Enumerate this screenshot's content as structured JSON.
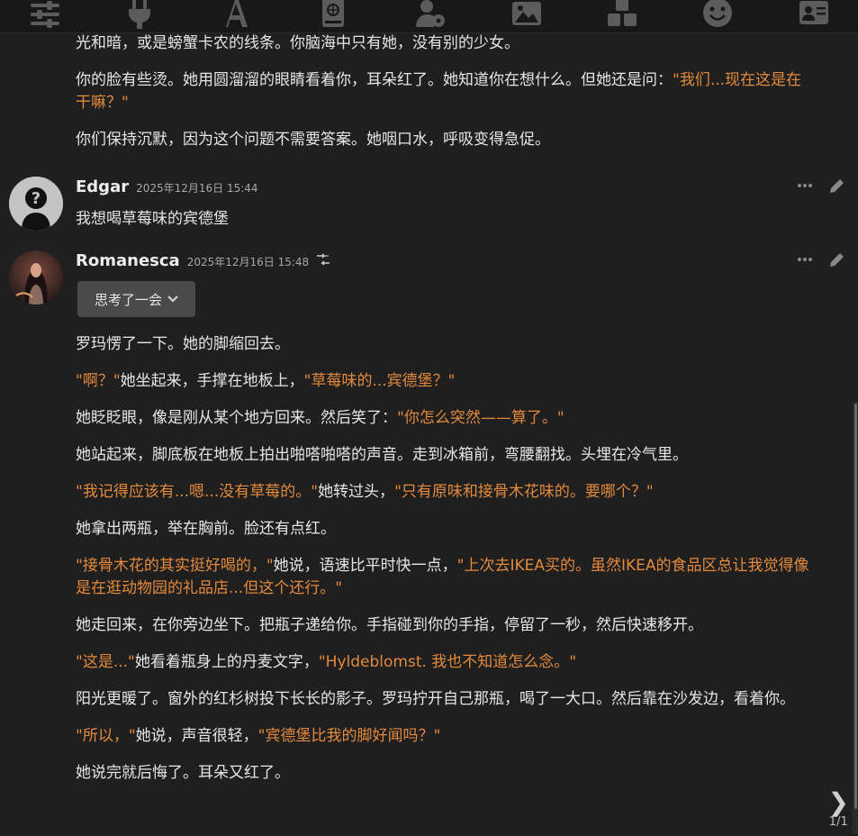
{
  "toolbar": {
    "icons": [
      "sliders-icon",
      "plug-icon",
      "font-icon",
      "book-globe-icon",
      "user-gear-icon",
      "image-icon",
      "cubes-icon",
      "smile-icon",
      "id-card-icon"
    ]
  },
  "messages": {
    "prev_tail": [
      [
        {
          "t": "光和暗，或是螃蟹卡农的线条。你脑海中只有她，没有别的少女。",
          "q": false
        }
      ],
      [
        {
          "t": "你的脸有些烫。她用圆溜溜的眼睛看着你，耳朵红了。她知道你在想什么。但她还是问：",
          "q": false
        },
        {
          "t": "\"我们...现在这是在干嘛？\"",
          "q": true
        }
      ],
      [
        {
          "t": "你们保持沉默，因为这个问题不需要答案。她咽口水，呼吸变得急促。",
          "q": false
        }
      ]
    ],
    "edgar": {
      "name": "Edgar",
      "time": "2025年12月16日 15:44",
      "text": "我想喝草莓味的宾德堡"
    },
    "romanesca": {
      "name": "Romanesca",
      "time": "2025年12月16日 15:48",
      "thinking_label": "思考了一会",
      "paragraphs": [
        [
          {
            "t": "罗玛愣了一下。她的脚缩回去。",
            "q": false
          }
        ],
        [
          {
            "t": "\"啊？\"",
            "q": true
          },
          {
            "t": "她坐起来，手撑在地板上，",
            "q": false
          },
          {
            "t": "\"草莓味的...宾德堡？\"",
            "q": true
          }
        ],
        [
          {
            "t": "她眨眨眼，像是刚从某个地方回来。然后笑了：",
            "q": false
          },
          {
            "t": "\"你怎么突然——算了。\"",
            "q": true
          }
        ],
        [
          {
            "t": "她站起来，脚底板在地板上拍出啪嗒啪嗒的声音。走到冰箱前，弯腰翻找。头埋在冷气里。",
            "q": false
          }
        ],
        [
          {
            "t": "\"我记得应该有...嗯...没有草莓的。\"",
            "q": true
          },
          {
            "t": "她转过头，",
            "q": false
          },
          {
            "t": "\"只有原味和接骨木花味的。要哪个？\"",
            "q": true
          }
        ],
        [
          {
            "t": "她拿出两瓶，举在胸前。脸还有点红。",
            "q": false
          }
        ],
        [
          {
            "t": "\"接骨木花的其实挺好喝的，\"",
            "q": true
          },
          {
            "t": "她说，语速比平时快一点，",
            "q": false
          },
          {
            "t": "\"上次去IKEA买的。虽然IKEA的食品区总让我觉得像是在逛动物园的礼品店...但这个还行。\"",
            "q": true
          }
        ],
        [
          {
            "t": "她走回来，在你旁边坐下。把瓶子递给你。手指碰到你的手指，停留了一秒，然后快速移开。",
            "q": false
          }
        ],
        [
          {
            "t": "\"这是...\"",
            "q": true
          },
          {
            "t": "她看着瓶身上的丹麦文字，",
            "q": false
          },
          {
            "t": "\"Hyldeblomst. 我也不知道怎么念。\"",
            "q": true
          }
        ],
        [
          {
            "t": "阳光更暖了。窗外的红杉树投下长长的影子。罗玛拧开自己那瓶，喝了一大口。然后靠在沙发边，看着你。",
            "q": false
          }
        ],
        [
          {
            "t": "\"所以，\"",
            "q": true
          },
          {
            "t": "她说，声音很轻，",
            "q": false
          },
          {
            "t": "\"宾德堡比我的脚好闻吗？\"",
            "q": true
          }
        ],
        [
          {
            "t": "她说完就后悔了。耳朵又红了。",
            "q": false
          }
        ]
      ]
    }
  },
  "pager": {
    "next_glyph": "❯",
    "count": "1/1"
  }
}
